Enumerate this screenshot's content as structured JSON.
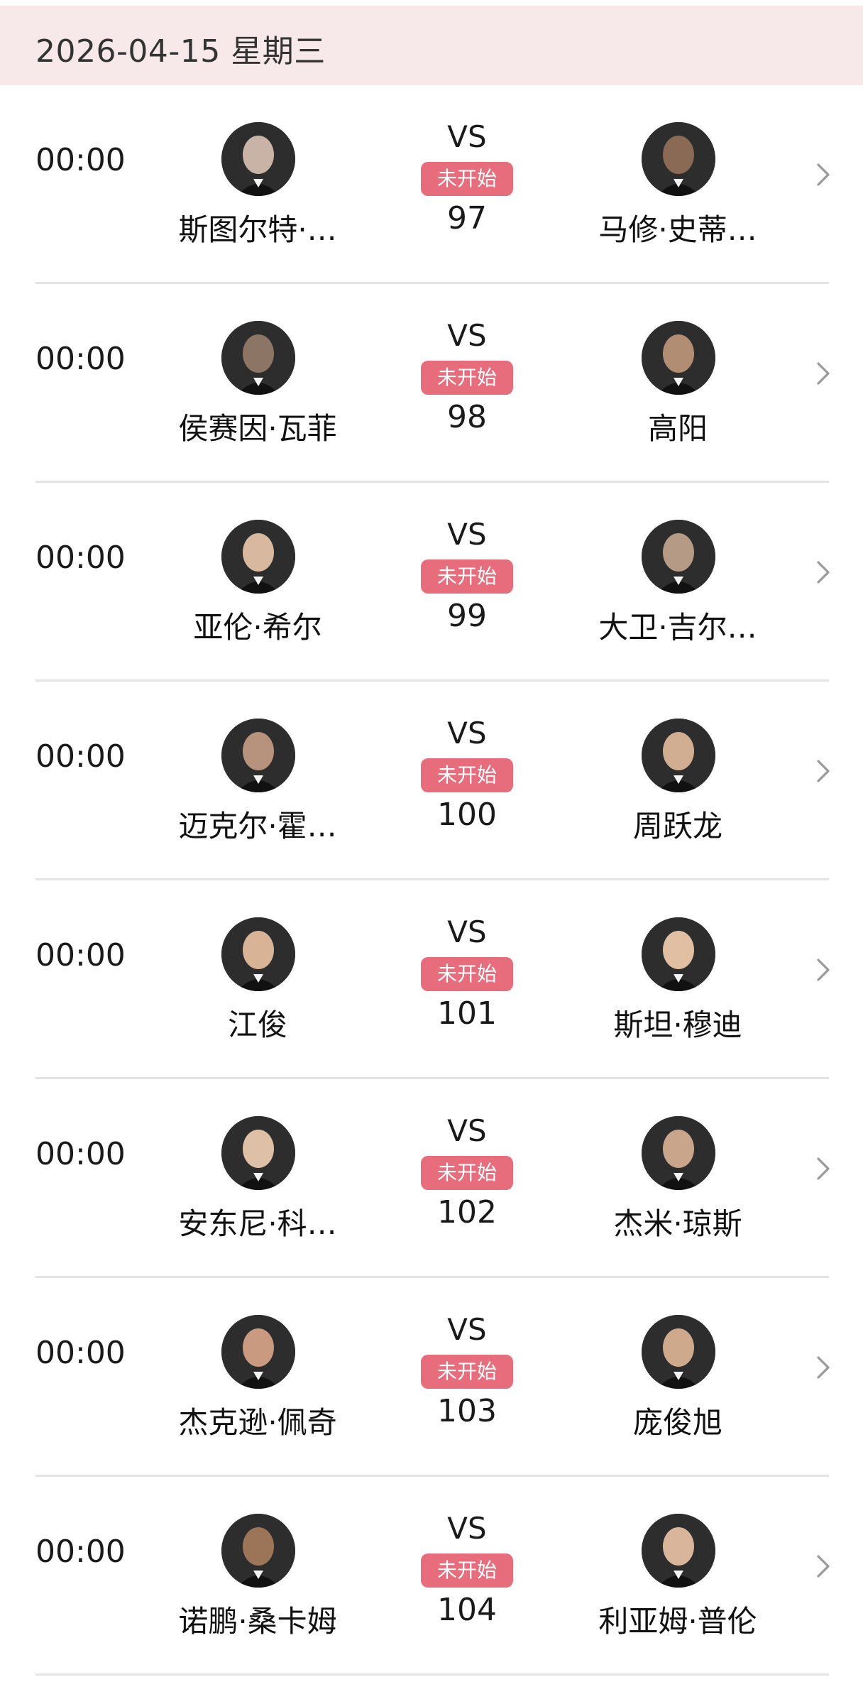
{
  "header": {
    "date": "2026-04-15 星期三"
  },
  "colors": {
    "header_bg": "#f7e8ea",
    "badge_bg": "#e86d7c",
    "divider": "#e4e4e4"
  },
  "matches": [
    {
      "time": "00:00",
      "home": "斯图尔特·…",
      "away": "马修·史蒂…",
      "vs": "VS",
      "status": "未开始",
      "number": "97",
      "home_tone": "#c9b3a6",
      "away_tone": "#8a6a55"
    },
    {
      "time": "00:00",
      "home": "侯赛因·瓦菲",
      "away": "高阳",
      "vs": "VS",
      "status": "未开始",
      "number": "98",
      "home_tone": "#8d7566",
      "away_tone": "#b08d73"
    },
    {
      "time": "00:00",
      "home": "亚伦·希尔",
      "away": "大卫·吉尔…",
      "vs": "VS",
      "status": "未开始",
      "number": "99",
      "home_tone": "#d8b9a0",
      "away_tone": "#b59a86"
    },
    {
      "time": "00:00",
      "home": "迈克尔·霍…",
      "away": "周跃龙",
      "vs": "VS",
      "status": "未开始",
      "number": "100",
      "home_tone": "#b7927c",
      "away_tone": "#d1ae92"
    },
    {
      "time": "00:00",
      "home": "江俊",
      "away": "斯坦·穆迪",
      "vs": "VS",
      "status": "未开始",
      "number": "101",
      "home_tone": "#d8b395",
      "away_tone": "#e0bfa2"
    },
    {
      "time": "00:00",
      "home": "安东尼·科…",
      "away": "杰米·琼斯",
      "vs": "VS",
      "status": "未开始",
      "number": "102",
      "home_tone": "#ddc0a5",
      "away_tone": "#c9a58c"
    },
    {
      "time": "00:00",
      "home": "杰克逊·佩奇",
      "away": "庞俊旭",
      "vs": "VS",
      "status": "未开始",
      "number": "103",
      "home_tone": "#c99a7f",
      "away_tone": "#cfa98c"
    },
    {
      "time": "00:00",
      "home": "诺鹏·桑卡姆",
      "away": "利亚姆·普伦",
      "vs": "VS",
      "status": "未开始",
      "number": "104",
      "home_tone": "#9c7558",
      "away_tone": "#d9b59c"
    }
  ]
}
